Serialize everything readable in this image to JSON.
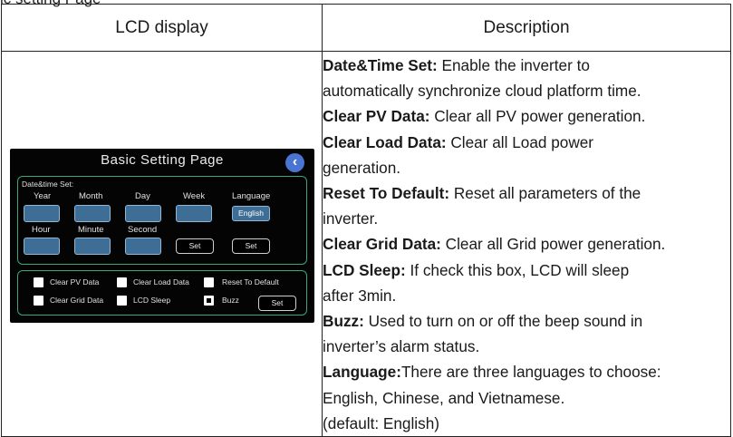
{
  "caption": "ic setting Page",
  "table": {
    "headers": [
      "LCD display",
      "Description"
    ]
  },
  "lcd": {
    "title": "Basic Setting Page",
    "back_icon": "chevron-left-icon",
    "datetime_label": "Date&time Set:",
    "year": "Year",
    "month": "Month",
    "day": "Day",
    "week": "Week",
    "language": "Language",
    "language_value": "English",
    "hour": "Hour",
    "minute": "Minute",
    "second": "Second",
    "set": "Set",
    "clear_pv": "Clear PV Data",
    "clear_load": "Clear Load Data",
    "reset_default": "Reset To Default",
    "clear_grid": "Clear Grid Data",
    "lcd_sleep": "LCD Sleep",
    "buzz": "Buzz",
    "buzz_checked": true,
    "accent_color": "#3aa679",
    "field_color": "#3e6e95",
    "back_color": "#4a74d2"
  },
  "description": [
    {
      "term": "Date&Time Set:",
      "lines": [
        " Enable the inverter to",
        "automatically synchronize cloud platform time."
      ]
    },
    {
      "term": "Clear PV Data:",
      "lines": [
        "  Clear all PV power generation."
      ]
    },
    {
      "term": "Clear Load Data:",
      "lines": [
        " Clear all Load power",
        "generation."
      ]
    },
    {
      "term": "Reset To Default:",
      "lines": [
        " Reset all parameters of the",
        "inverter."
      ]
    },
    {
      "term": "Clear Grid Data:",
      "lines": [
        " Clear all Grid power generation."
      ]
    },
    {
      "term": "LCD Sleep:",
      "lines": [
        " If check this box, LCD will sleep",
        "after 3min."
      ]
    },
    {
      "term": "Buzz:",
      "lines": [
        " Used to turn on or off the beep sound in",
        "inverter’s alarm status."
      ]
    },
    {
      "term": "Language:",
      "lines": [
        "There are three languages to choose:",
        "English, Chinese, and Vietnamese.",
        "(default: English)"
      ]
    }
  ]
}
